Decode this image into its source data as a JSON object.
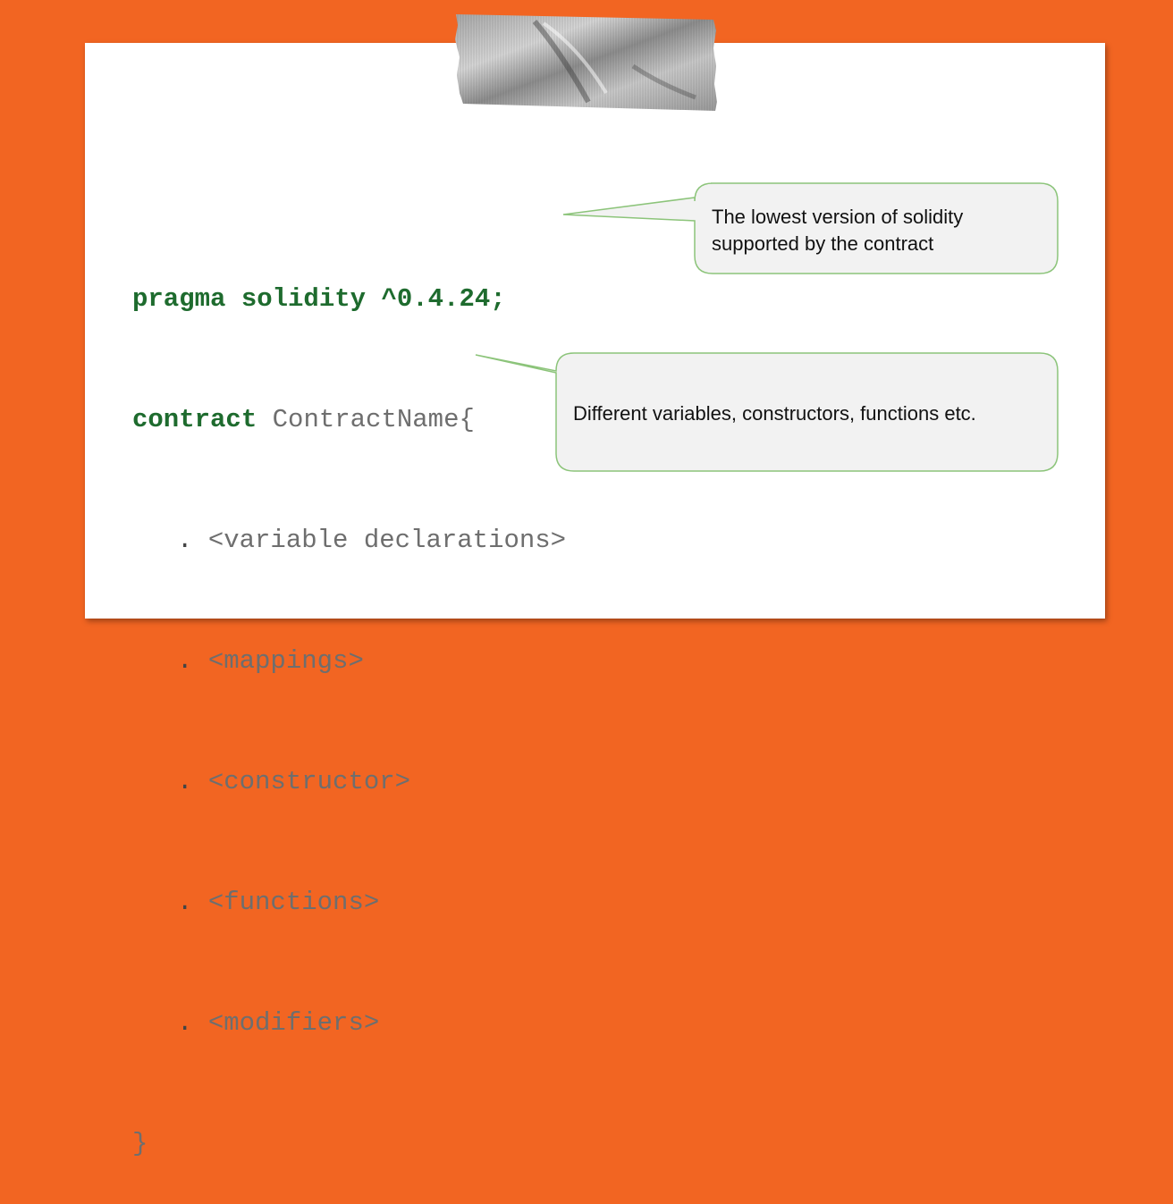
{
  "code": {
    "pragma_line": "pragma solidity ^0.4.24;",
    "contract_keyword": "contract",
    "contract_name": " ContractName{",
    "bullet": ".",
    "items": [
      "<variable declarations>",
      "<mappings>",
      "<constructor>",
      "<functions>",
      "<modifiers>"
    ],
    "closing_brace": "}"
  },
  "callouts": {
    "version_note_line1": "The lowest version of solidity",
    "version_note_line2": "supported by the contract",
    "members_note": "Different variables, constructors, functions etc."
  },
  "colors": {
    "background": "#f26522",
    "card": "#ffffff",
    "keyword": "#1e6b2e",
    "code_text": "#6e6e6e",
    "callout_fill": "#f2f2f2",
    "callout_border": "#8cc47a"
  },
  "decoration": {
    "tape": "duct-tape"
  }
}
